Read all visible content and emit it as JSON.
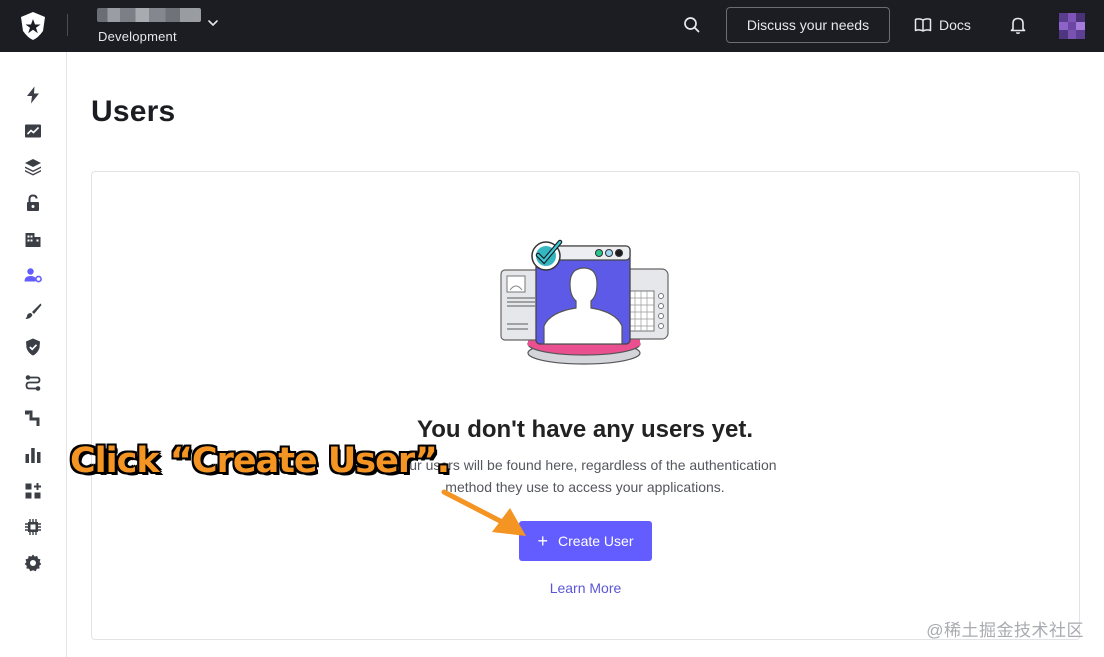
{
  "topbar": {
    "tenant_env": "Development",
    "discuss_label": "Discuss your needs",
    "docs_label": "Docs"
  },
  "sidebar": {
    "items": [
      {
        "icon": "lightning-icon"
      },
      {
        "icon": "activity-chart-icon"
      },
      {
        "icon": "layers-icon"
      },
      {
        "icon": "lock-icon"
      },
      {
        "icon": "building-icon"
      },
      {
        "icon": "users-gear-icon"
      },
      {
        "icon": "brush-icon"
      },
      {
        "icon": "shield-check-icon"
      },
      {
        "icon": "flow-icon"
      },
      {
        "icon": "pipeline-icon"
      },
      {
        "icon": "bar-chart-icon"
      },
      {
        "icon": "extensions-icon"
      },
      {
        "icon": "chip-icon"
      },
      {
        "icon": "settings-icon"
      }
    ]
  },
  "main": {
    "title": "Users",
    "empty_title": "You don't have any users yet.",
    "empty_desc_line1": "Your users will be found here, regardless of the authentication",
    "empty_desc_line2": "method they use to access your applications.",
    "create_label": "Create User",
    "learn_more_label": "Learn More"
  },
  "annotation": {
    "callout": "Click “Create User”."
  },
  "watermark": "@稀土掘金技术社区",
  "colors": {
    "topbar_bg": "#1b1d22",
    "primary": "#635dff",
    "callout": "#f39423"
  }
}
